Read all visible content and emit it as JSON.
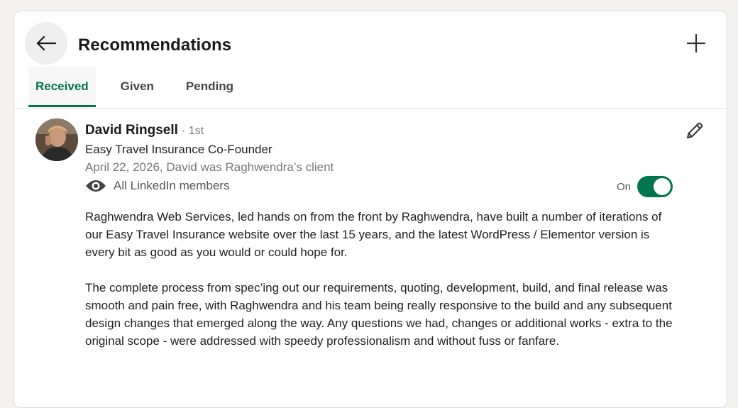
{
  "header": {
    "title": "Recommendations",
    "back_icon": "arrow-left-icon",
    "add_icon": "plus-icon"
  },
  "tabs": [
    {
      "label": "Received",
      "active": true
    },
    {
      "label": "Given",
      "active": false
    },
    {
      "label": "Pending",
      "active": false
    }
  ],
  "recommendation": {
    "name": "David Ringsell",
    "degree": "· 1st",
    "headline": "Easy Travel Insurance Co-Founder",
    "meta": "April 22, 2026, David was Raghwendra’s client",
    "visibility": "All LinkedIn members",
    "visibility_icon": "eye-icon",
    "toggle_label": "On",
    "toggle_on": true,
    "edit_icon": "pencil-icon",
    "paragraphs": [
      "Raghwendra Web Services, led hands on from the front by Raghwendra, have built a number of iterations of our Easy Travel Insurance website over the last 15 years, and the latest WordPress / Elementor version is every bit as good as you would or could hope for.",
      "The complete process from spec’ing out our requirements, quoting, development, build, and final release was smooth and pain free, with Raghwendra and his team being really responsive to the build and any subsequent design changes that emerged along the way. Any questions we had, changes or additional works - extra to the original scope - were addressed with speedy professionalism and without fuss or fanfare."
    ]
  },
  "colors": {
    "accent": "#01754f",
    "background": "#f4f2ee",
    "card": "#ffffff"
  }
}
